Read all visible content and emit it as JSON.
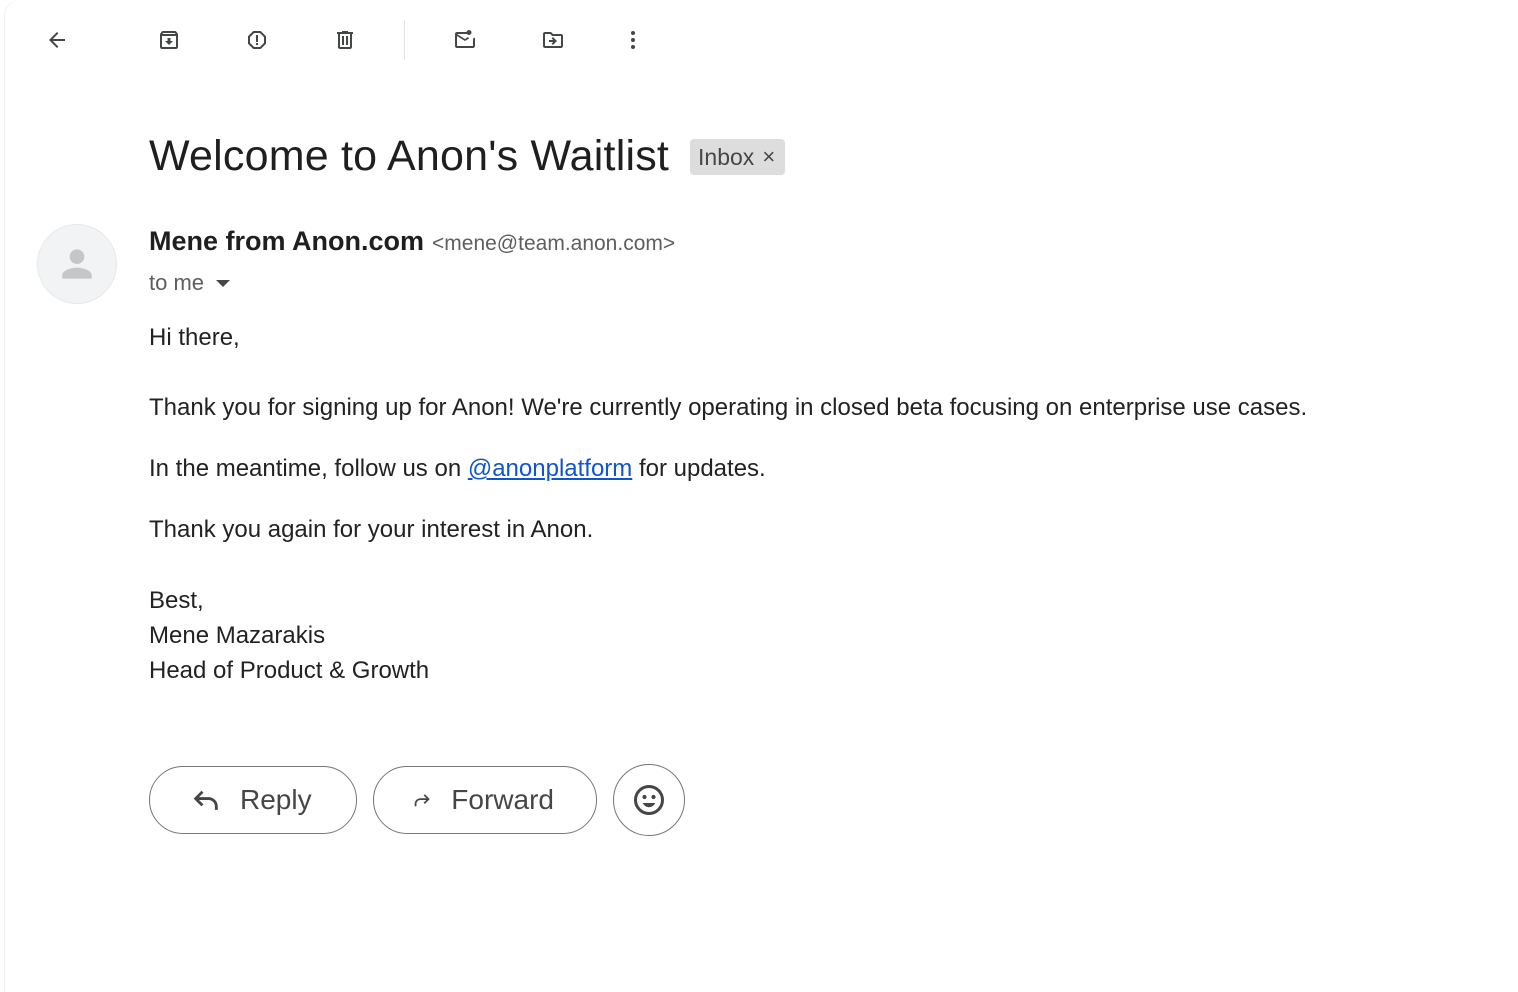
{
  "toolbar": {
    "icons": [
      "back-arrow-icon",
      "archive-icon",
      "report-spam-icon",
      "delete-icon",
      "mark-unread-icon",
      "move-to-icon",
      "more-options-icon"
    ]
  },
  "email": {
    "subject": "Welcome to Anon's Waitlist",
    "label": "Inbox",
    "label_remove": "×",
    "sender_name": "Mene from Anon.com",
    "sender_email": "<mene@team.anon.com>",
    "recipient": "to me",
    "body": {
      "greeting": "Hi there,",
      "para1": "Thank you for signing up for Anon! We're currently operating in closed beta focusing on enterprise use cases.",
      "para2_before": "In the meantime, follow us on ",
      "para2_link": "@anonplatform",
      "para2_after": " for updates.",
      "para3": "Thank you again for your interest in Anon.",
      "signoff": "Best,",
      "sig_name": "Mene Mazarakis",
      "sig_title": "Head of Product & Growth"
    }
  },
  "actions": {
    "reply": "Reply",
    "forward": "Forward"
  },
  "colors": {
    "link": "#1155cc",
    "chip_bg": "#dddddd",
    "icon": "#444746"
  }
}
